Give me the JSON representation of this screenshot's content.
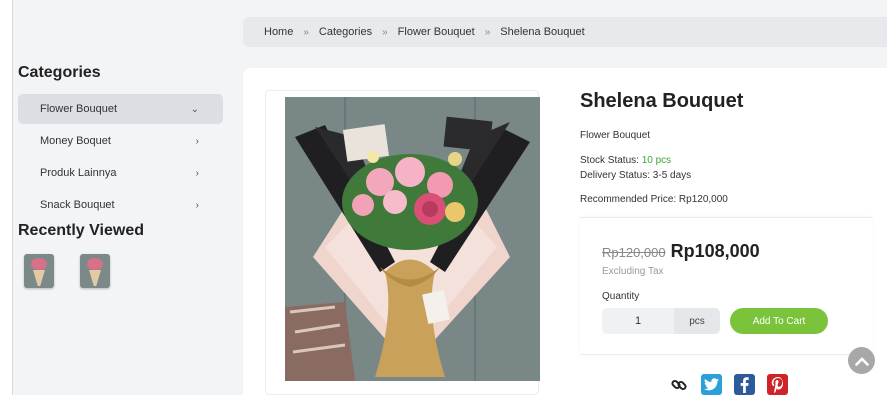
{
  "breadcrumb": {
    "items": [
      "Home",
      "Categories",
      "Flower Bouquet",
      "Shelena Bouquet"
    ],
    "separator": "»"
  },
  "sidebar": {
    "categories_title": "Categories",
    "categories": [
      {
        "label": "Flower Bouquet",
        "active": true
      },
      {
        "label": "Money Boquet",
        "active": false
      },
      {
        "label": "Produk Lainnya",
        "active": false
      },
      {
        "label": "Snack Bouquet",
        "active": false
      }
    ],
    "recent_title": "Recently Viewed"
  },
  "product": {
    "title": "Shelena Bouquet",
    "category": "Flower Bouquet",
    "stock_label": "Stock Status: ",
    "stock_value": "10 pcs",
    "delivery": "Delivery Status: 3-5 days",
    "recommended": "Recommended Price: Rp120,000"
  },
  "pricing": {
    "old_price": "Rp120,000",
    "new_price": "Rp108,000",
    "tax_note": "Excluding Tax",
    "quantity_label": "Quantity",
    "quantity_value": "1",
    "unit": "pcs",
    "add_to_cart": "Add To Cart"
  },
  "share": {
    "icons": [
      "link-icon",
      "twitter-icon",
      "facebook-icon",
      "pinterest-icon"
    ]
  },
  "colors": {
    "accent_green": "#7bc33a",
    "stock_green": "#3fa53a",
    "twitter": "#2a9fd8",
    "facebook": "#2d5a98",
    "pinterest": "#cf2329"
  }
}
